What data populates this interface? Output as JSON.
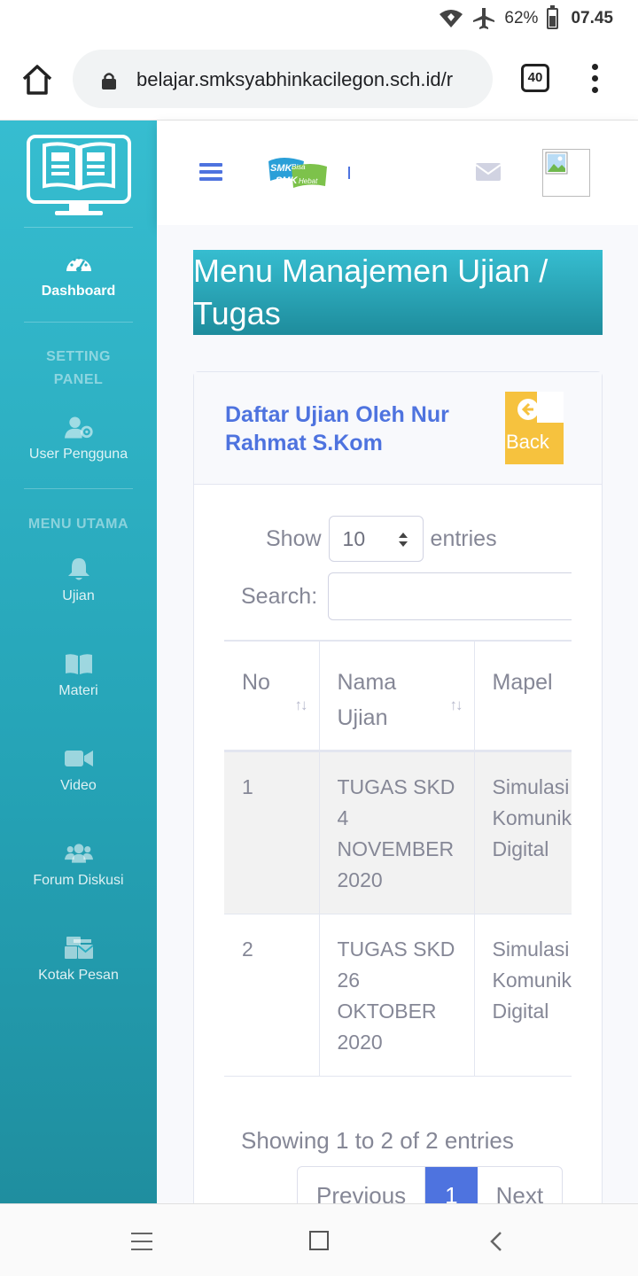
{
  "status_bar": {
    "battery": "62%",
    "time": "07.45",
    "icons": [
      "wifi-icon",
      "airplane-icon",
      "battery-icon"
    ]
  },
  "browser": {
    "url": "belajar.smksyabhinkacilegon.sch.id/r",
    "tab_count": "40",
    "icons": [
      "home-icon",
      "lock-icon",
      "kebab-menu-icon"
    ]
  },
  "sidebar": {
    "brand_icon": "monitor-book-icon",
    "dashboard": {
      "label": "Dashboard",
      "icon": "tachometer-icon"
    },
    "setting_heading": "SETTING PANEL",
    "user_pengguna": {
      "label": "User Pengguna",
      "icon": "user-cog-icon"
    },
    "menu_heading": "MENU UTAMA",
    "items": [
      {
        "label": "Ujian",
        "icon": "bell-icon"
      },
      {
        "label": "Materi",
        "icon": "book-open-icon"
      },
      {
        "label": "Video",
        "icon": "video-icon"
      },
      {
        "label": "Forum Diskusi",
        "icon": "users-icon"
      },
      {
        "label": "Kotak Pesan",
        "icon": "mail-bulk-icon"
      }
    ]
  },
  "topbar": {
    "logo_text_1": "SMK",
    "logo_text_2": "Bisa",
    "logo_text_3": "SMK",
    "logo_text_4": "Hebat",
    "icons": [
      "hamburger-icon",
      "envelope-icon",
      "avatar-broken-image"
    ]
  },
  "page": {
    "title": "Menu Manajemen Ujian / Tugas"
  },
  "card": {
    "title": "Daftar Ujian Oleh Nur Rahmat S.Kom",
    "back_label": "Back"
  },
  "datatable": {
    "show_label": "Show",
    "entries_value": "10",
    "entries_label": "entries",
    "search_label": "Search:",
    "columns": [
      "No",
      "Nama Ujian",
      "Mapel"
    ],
    "rows": [
      {
        "no": "1",
        "nama": "TUGAS SKD 4 NOVEMBER 2020",
        "mapel": "Simulasi dan Komunikasi Digital"
      },
      {
        "no": "2",
        "nama": "TUGAS SKD 26 OKTOBER 2020",
        "mapel": "Simulasi dan Komunikasi Digital"
      }
    ],
    "info": "Showing 1 to 2 of 2 entries",
    "pagination": {
      "previous": "Previous",
      "current": "1",
      "next": "Next"
    }
  },
  "colors": {
    "sidebar_top": "#36bdd0",
    "sidebar_bottom": "#1f8e9f",
    "primary": "#4e73df",
    "warning": "#f6c23e",
    "text_muted": "#858796"
  }
}
